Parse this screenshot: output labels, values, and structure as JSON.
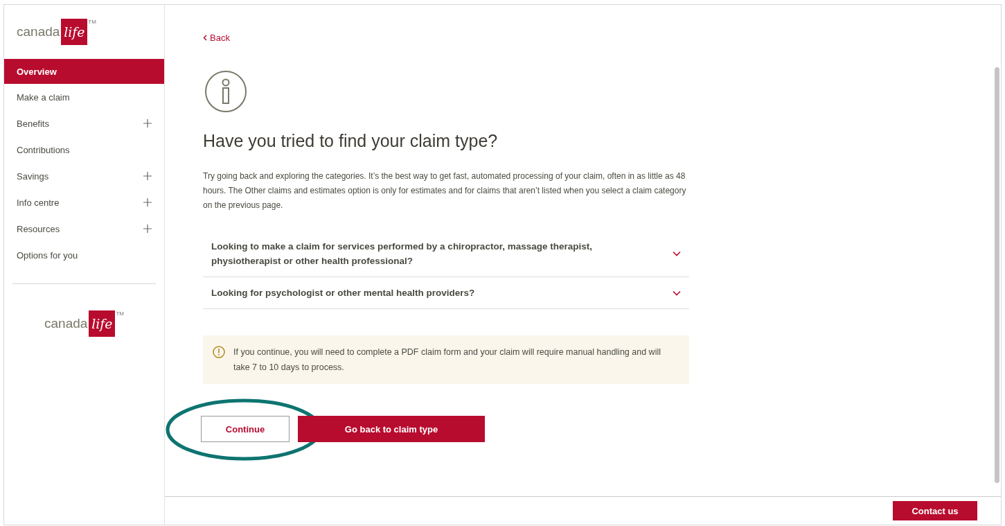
{
  "sidebar": {
    "logo": {
      "word": "canada",
      "mark": "life",
      "trademark": "TM"
    },
    "items": [
      {
        "label": "Overview",
        "selected": true,
        "expandable": false
      },
      {
        "label": "Make a claim",
        "selected": false,
        "expandable": false
      },
      {
        "label": "Benefits",
        "selected": false,
        "expandable": true
      },
      {
        "label": "Contributions",
        "selected": false,
        "expandable": false
      },
      {
        "label": "Savings",
        "selected": false,
        "expandable": true
      },
      {
        "label": "Info centre",
        "selected": false,
        "expandable": true
      },
      {
        "label": "Resources",
        "selected": false,
        "expandable": true
      },
      {
        "label": "Options for you",
        "selected": false,
        "expandable": false
      }
    ],
    "footer_logo": {
      "word": "canada",
      "mark": "life",
      "trademark": "TM"
    }
  },
  "main": {
    "back_link": "Back",
    "heading": "Have you tried to find your claim type?",
    "intro": "Try going back and exploring the categories. It’s the best way to get fast, automated processing of your claim, often in as little as 48 hours. The Other claims and estimates option is only for estimates and for claims that aren’t listed when you select a claim category on the previous page.",
    "accordion": [
      {
        "question": "Looking to make a claim for services performed by a chiropractor, massage therapist, physiotherapist or other health professional?",
        "expanded": false
      },
      {
        "question": "Looking for psychologist or other mental health providers?",
        "expanded": false
      }
    ],
    "notice": "If you continue, you will need to complete a PDF claim form and your claim will require manual handling and will take 7 to 10 days to process.",
    "buttons": [
      {
        "label": "Continue",
        "kind": "secondary",
        "highlighted": true
      },
      {
        "label": "Go back to claim type",
        "kind": "primary",
        "highlighted": false
      }
    ]
  },
  "footer": {
    "contact_button": "Contact us"
  }
}
